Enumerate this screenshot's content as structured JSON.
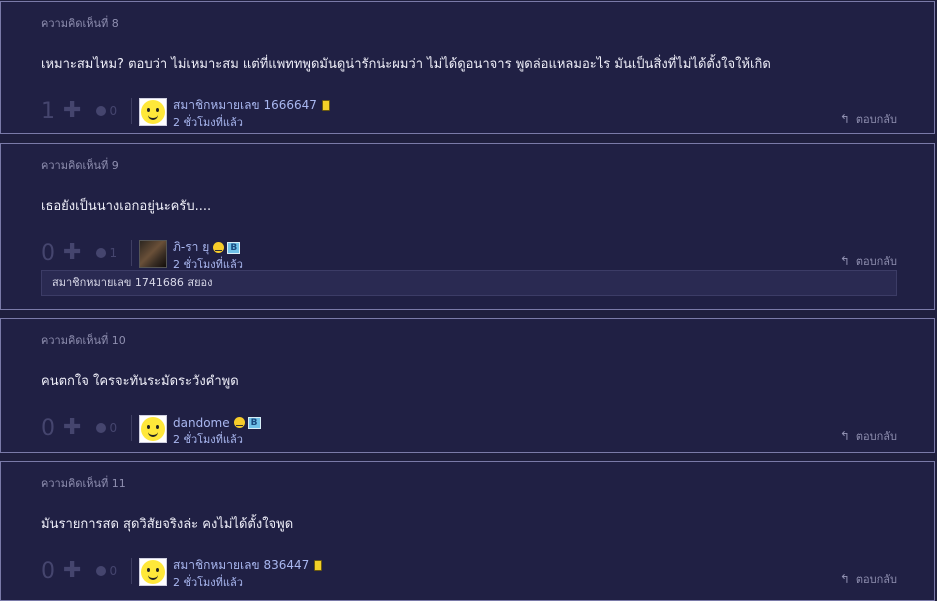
{
  "comments": [
    {
      "header": "ความคิดเห็นที่ 8",
      "body": "เหมาะสมไหม? ตอบว่า ไม่เหมาะสม แต่ที่แพททพูดมันดูน่ารักน่ะผมว่า ไม่ได้ดูอนาจาร พูดล่อแหลมอะไร มันเป็นสิ่งที่ไม่ได้ตั้งใจให้เกิด",
      "score": "1",
      "emotion_count": "0",
      "username": "สมาชิกหมายเลข 1666647",
      "time": "2 ชั่วโมงที่แล้ว",
      "reply_label": "ตอบกลับ"
    },
    {
      "header": "ความคิดเห็นที่ 9",
      "body": "เธอยังเป็นนางเอกอยู่นะครับ....",
      "score": "0",
      "emotion_count": "1",
      "username": "ภิ-รา ยุ",
      "time": "2 ชั่วโมงที่แล้ว",
      "reply_label": "ตอบกลับ",
      "sub_reply": "สมาชิกหมายเลข 1741686 สยอง"
    },
    {
      "header": "ความคิดเห็นที่ 10",
      "body": "คนตกใจ  ใครจะทันระมัดระวังคำพูด",
      "score": "0",
      "emotion_count": "0",
      "username": "dandome",
      "time": "2 ชั่วโมงที่แล้ว",
      "reply_label": "ตอบกลับ"
    },
    {
      "header": "ความคิดเห็นที่ 11",
      "body": "มันรายการสด สุดวิสัยจริงล่ะ คงไม่ได้ตั้งใจพูด",
      "score": "0",
      "emotion_count": "0",
      "username": "สมาชิกหมายเลข 836447",
      "time": "2 ชั่วโมงที่แล้ว",
      "reply_label": "ตอบกลับ"
    }
  ],
  "icons": {
    "plus": "plus-icon",
    "emotion": "emotion-face-icon",
    "reply": "reply-arrow-icon",
    "phone_badge": "mobile-phone-badge-icon",
    "smile_badge": "smile-badge-icon",
    "blog_badge": "blog-b-badge-icon"
  },
  "colors": {
    "background": "#1f1f3e",
    "card": "#202044",
    "username": "#a9b7f0",
    "muted": "#8f8fb0"
  }
}
